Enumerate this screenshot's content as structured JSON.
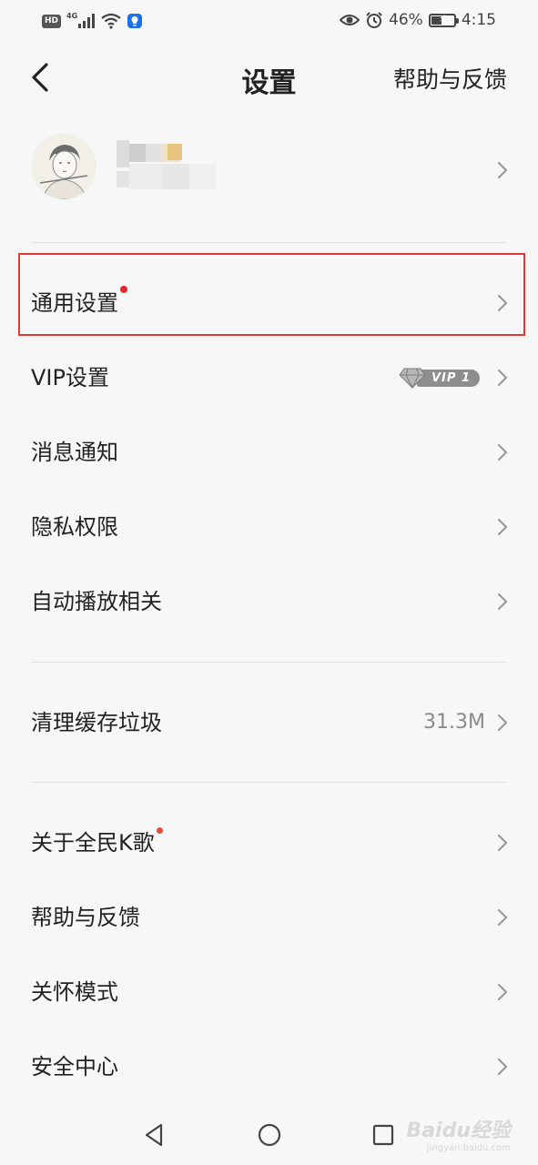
{
  "status_bar": {
    "hd": "HD",
    "network": "4G",
    "battery_percent": "46%",
    "battery_level": 0.46,
    "time": "4:15",
    "icons": [
      "signal-icon",
      "wifi-icon",
      "shield-icon",
      "eye-icon",
      "alarm-icon",
      "battery-charging-icon"
    ]
  },
  "header": {
    "title": "设置",
    "back_icon": "chevron-left-icon",
    "help_link": "帮助与反馈"
  },
  "profile": {
    "avatar": "user-avatar"
  },
  "groups": [
    {
      "items": [
        {
          "label": "通用设置",
          "has_dot": true
        },
        {
          "label": "VIP设置",
          "badge": "VIP 1"
        },
        {
          "label": "消息通知"
        },
        {
          "label": "隐私权限"
        },
        {
          "label": "自动播放相关"
        }
      ]
    },
    {
      "items": [
        {
          "label": "清理缓存垃圾",
          "value": "31.3M"
        }
      ]
    },
    {
      "items": [
        {
          "label": "关于全民K歌",
          "has_dot": true
        },
        {
          "label": "帮助与反馈"
        },
        {
          "label": "关怀模式"
        },
        {
          "label": "安全中心"
        }
      ]
    }
  ],
  "colors": {
    "background": "#f7f7f7",
    "notification_dot": "#e32a2a",
    "highlight_border": "#e53935",
    "value_text": "#8a8a8a"
  },
  "watermark": {
    "text": "Baidu经验",
    "sub": "jingyan.baidu.com"
  }
}
